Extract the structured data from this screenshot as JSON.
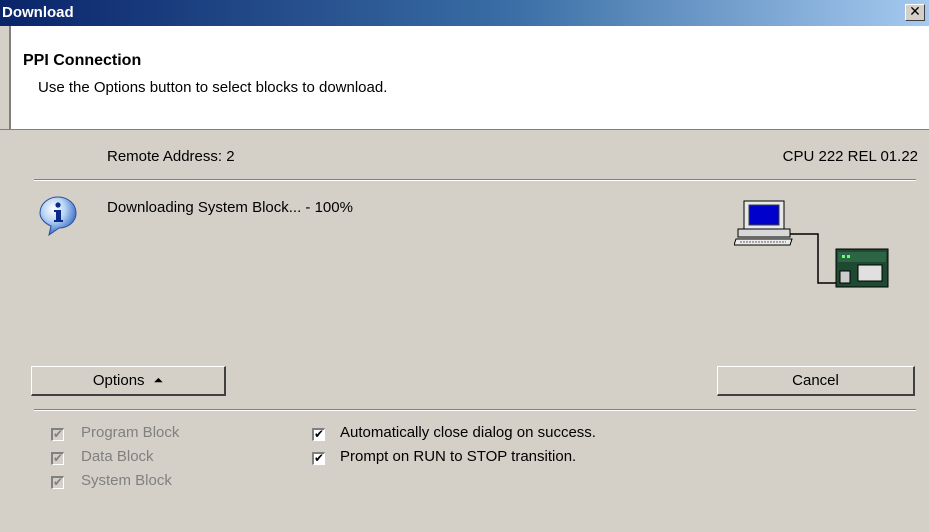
{
  "window": {
    "title": "Download",
    "close_glyph": "✕"
  },
  "header": {
    "title": "PPI Connection",
    "subtitle": "Use the Options button to select blocks to download."
  },
  "status": {
    "remote_address": "Remote Address: 2",
    "cpu_info": "CPU 222 REL 01.22",
    "message": "Downloading System Block... - 100%",
    "icon": "info-icon",
    "connection_icon": "pc-to-plc-connection-icon"
  },
  "buttons": {
    "options_label": "Options",
    "options_arrow": "⏶",
    "cancel_label": "Cancel"
  },
  "blocks": [
    {
      "label": "Program Block",
      "checked": true,
      "enabled": false
    },
    {
      "label": "Data Block",
      "checked": true,
      "enabled": false
    },
    {
      "label": "System Block",
      "checked": true,
      "enabled": false
    }
  ],
  "options": [
    {
      "label": "Automatically close dialog on success.",
      "checked": true
    },
    {
      "label": "Prompt on RUN to STOP transition.",
      "checked": true
    }
  ],
  "colors": {
    "titlebar_start": "#0a246a",
    "titlebar_end": "#a6caf0",
    "face": "#d4d0c8",
    "disabled_text": "#808080"
  }
}
